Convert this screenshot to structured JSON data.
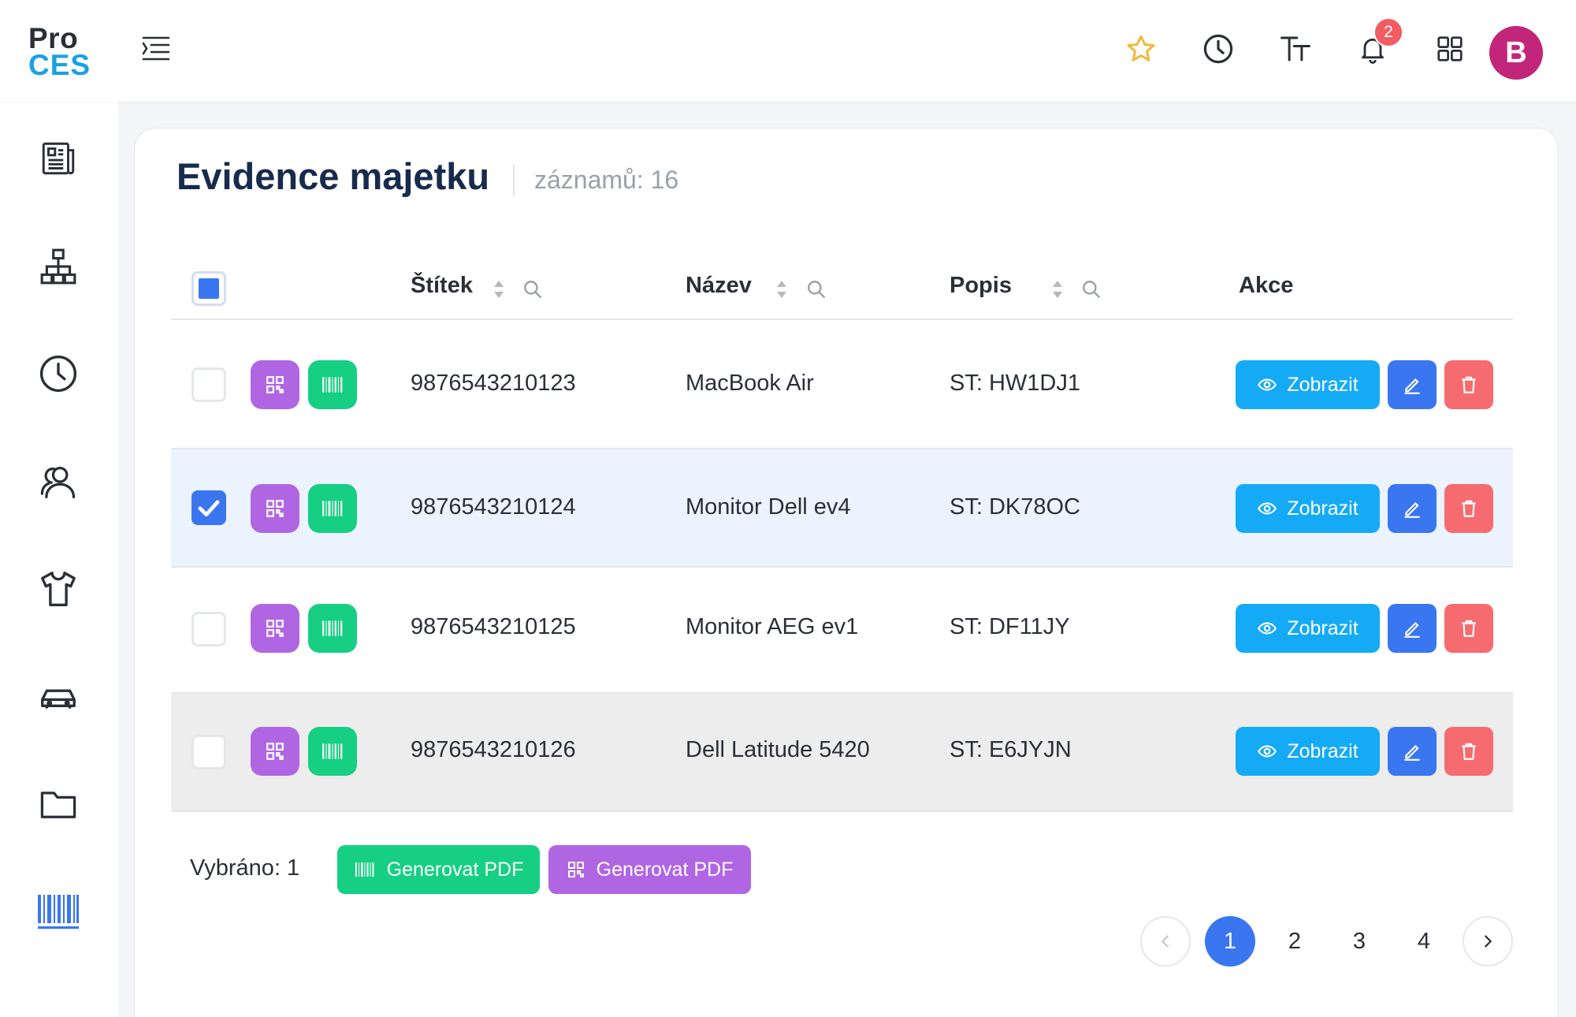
{
  "app": {
    "logo_line1": "Pro",
    "logo_line2": "CES"
  },
  "header": {
    "notifications_count": "2",
    "avatar_initial": "B"
  },
  "page": {
    "title": "Evidence majetku",
    "record_count": "záznamů: 16"
  },
  "table": {
    "columns": {
      "tag": "Štítek",
      "name": "Název",
      "description": "Popis",
      "actions": "Akce"
    },
    "rows": [
      {
        "tag": "9876543210123",
        "name": "MacBook Air",
        "description": "ST: HW1DJ1",
        "selected": false
      },
      {
        "tag": "9876543210124",
        "name": "Monitor Dell ev4",
        "description": "ST: DK78OC",
        "selected": true
      },
      {
        "tag": "9876543210125",
        "name": "Monitor AEG ev1",
        "description": "ST: DF11JY",
        "selected": false
      },
      {
        "tag": "9876543210126",
        "name": "Dell Latitude 5420",
        "description": "ST: E6JYJN",
        "selected": false
      }
    ],
    "view_label": "Zobrazit"
  },
  "footer": {
    "selected_text": "Vybráno: 1",
    "generate_barcode_pdf": "Generovat PDF",
    "generate_qr_pdf": "Generovat PDF"
  },
  "pagination": {
    "pages": [
      "1",
      "2",
      "3",
      "4"
    ],
    "current": "1"
  },
  "colors": {
    "primary": "#3a76f0",
    "info": "#15aaf5",
    "danger": "#f56b70",
    "qr": "#b066e3",
    "barcode": "#16cf83",
    "selected_row": "#ebf3fe",
    "hover_row": "#ededed"
  },
  "icons": {
    "header": [
      "menu-toggle-icon",
      "star-icon",
      "history-icon",
      "font-size-icon",
      "bell-icon",
      "apps-grid-icon"
    ],
    "sidebar": [
      "news-icon",
      "org-chart-icon",
      "clock-icon",
      "users-icon",
      "tshirt-icon",
      "car-icon",
      "folder-icon",
      "barcode-icon"
    ]
  }
}
